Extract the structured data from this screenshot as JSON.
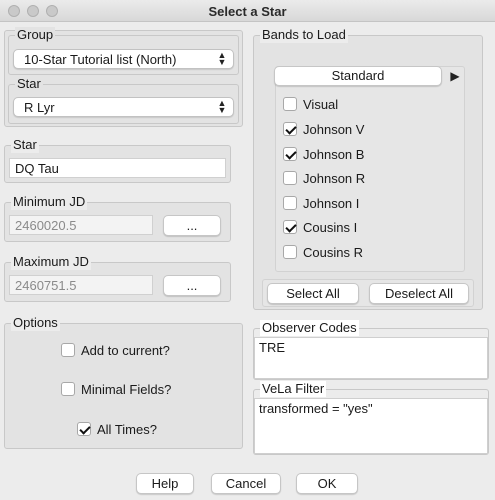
{
  "window": {
    "title": "Select a Star"
  },
  "group": {
    "label": "Group",
    "selected": "10-Star Tutorial list (North)"
  },
  "star_select": {
    "label": "Star",
    "selected": "R Lyr"
  },
  "star_entry": {
    "label": "Star",
    "value": "DQ Tau"
  },
  "min_jd": {
    "label": "Minimum JD",
    "placeholder": "2460020.5",
    "button": "..."
  },
  "max_jd": {
    "label": "Maximum JD",
    "placeholder": "2460751.5",
    "button": "..."
  },
  "options": {
    "label": "Options",
    "items": [
      {
        "label": "Add to current?",
        "checked": false
      },
      {
        "label": "Minimal Fields?",
        "checked": false
      },
      {
        "label": "All Times?",
        "checked": true
      }
    ]
  },
  "bands": {
    "label": "Bands to Load",
    "tab": "Standard",
    "tab_arrow": "▶",
    "items": [
      {
        "label": "Visual",
        "checked": false
      },
      {
        "label": "Johnson V",
        "checked": true
      },
      {
        "label": "Johnson B",
        "checked": true
      },
      {
        "label": "Johnson R",
        "checked": false
      },
      {
        "label": "Johnson I",
        "checked": false
      },
      {
        "label": "Cousins I",
        "checked": true
      },
      {
        "label": "Cousins R",
        "checked": false
      }
    ],
    "select_all": "Select All",
    "deselect_all": "Deselect All"
  },
  "observer_codes": {
    "label": "Observer Codes",
    "value": "TRE"
  },
  "vela_filter": {
    "label": "VeLa Filter",
    "value": "transformed = \"yes\""
  },
  "footer": {
    "help": "Help",
    "cancel": "Cancel",
    "ok": "OK"
  },
  "colors": {
    "background": "#ececec",
    "groupbox": "#e3e3e3",
    "field": "#ffffff"
  }
}
